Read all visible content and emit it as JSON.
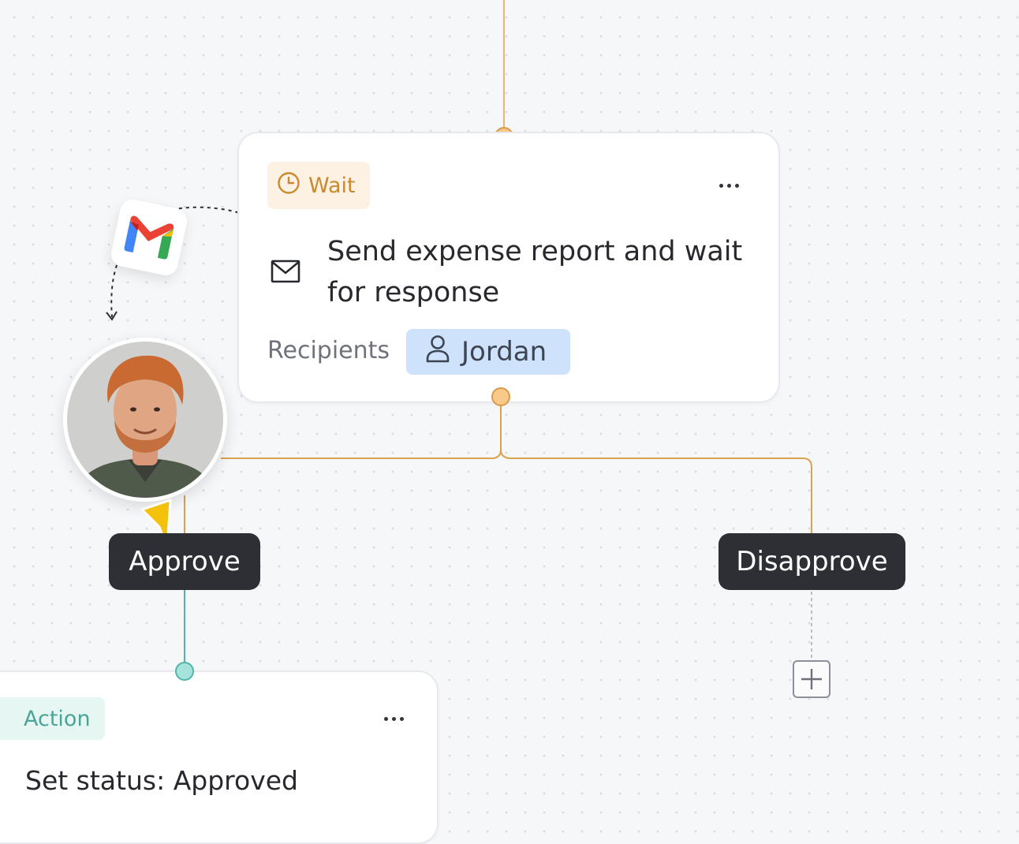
{
  "wait_card": {
    "badge_label": "Wait",
    "badge_icon": "clock-icon",
    "title": "Send expense report and wait for response",
    "title_icon": "mail-icon",
    "recipients_label": "Recipients",
    "recipient": {
      "name": "Jordan",
      "icon": "user-icon"
    },
    "menu_icon": "more-icon"
  },
  "branches": {
    "approve_label": "Approve",
    "disapprove_label": "Disapprove",
    "add_icon": "plus-icon"
  },
  "action_card": {
    "badge_label": "Action",
    "title": "Set status: Approved",
    "menu_icon": "more-icon"
  },
  "decorations": {
    "gmail_icon": "gmail-icon",
    "avatar": "user-photo",
    "cursor": "pointer-cursor-icon"
  },
  "colors": {
    "connector": "#d9a24f",
    "connector_teal": "#4fb5a8",
    "wait_accent": "#c98a2e",
    "action_accent": "#4aa596",
    "chip_bg": "#cfe2fb",
    "pill_bg": "#2d2f34"
  }
}
